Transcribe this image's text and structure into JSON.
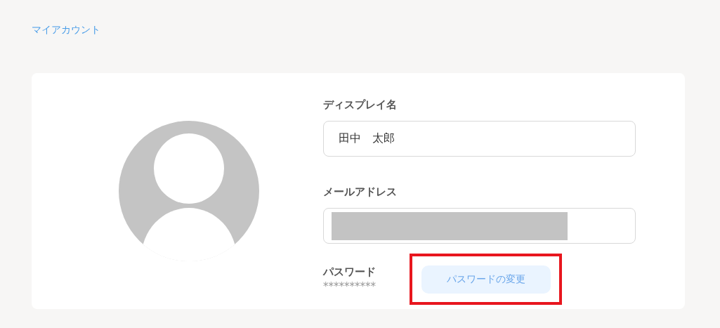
{
  "breadcrumb": {
    "label": "マイアカウント"
  },
  "profile": {
    "fields": [
      {
        "label": "ディスプレイ名",
        "value": "田中　太郎",
        "redacted": false
      },
      {
        "label": "メールアドレス",
        "redacted": true
      }
    ],
    "password": {
      "label": "パスワード",
      "masked": "**********",
      "button": "パスワードの変更",
      "highlighted": true
    }
  }
}
